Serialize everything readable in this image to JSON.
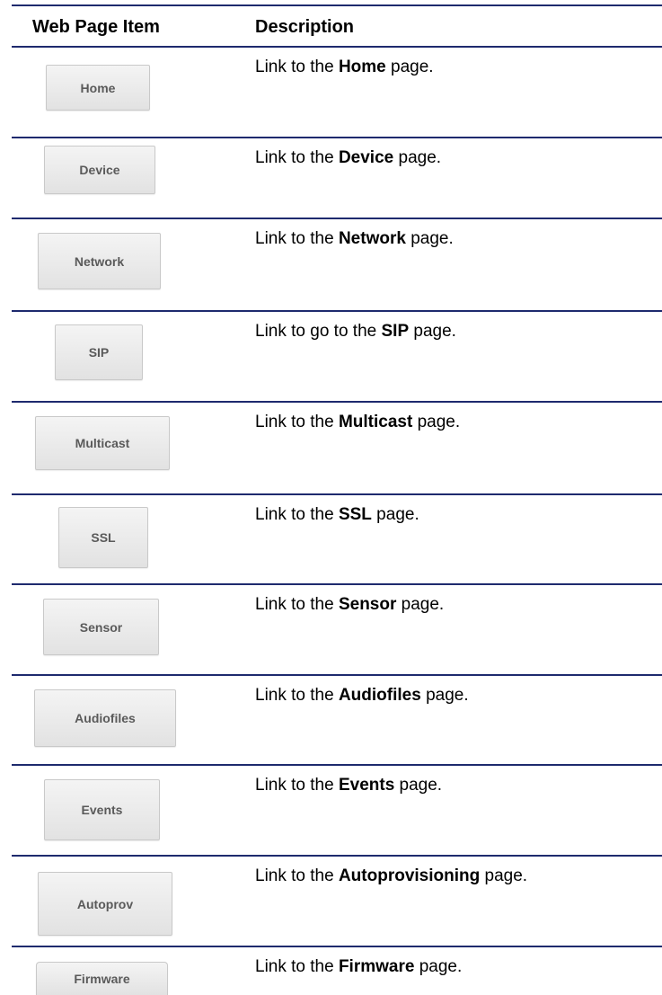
{
  "header": {
    "item_col": "Web Page Item",
    "desc_col": "Description"
  },
  "rows": [
    {
      "button": "Home",
      "prefix": "Link to the ",
      "bold": "Home",
      "suffix": " page."
    },
    {
      "button": "Device",
      "prefix": "Link to the ",
      "bold": "Device",
      "suffix": " page."
    },
    {
      "button": "Network",
      "prefix": "Link to the ",
      "bold": "Network",
      "suffix": " page."
    },
    {
      "button": "SIP",
      "prefix": "Link to go to the ",
      "bold": "SIP",
      "suffix": " page."
    },
    {
      "button": "Multicast",
      "prefix": "Link to the ",
      "bold": "Multicast",
      "suffix": " page."
    },
    {
      "button": "SSL",
      "prefix": "Link to the ",
      "bold": "SSL",
      "suffix": " page."
    },
    {
      "button": "Sensor",
      "prefix": "Link to the ",
      "bold": "Sensor",
      "suffix": " page."
    },
    {
      "button": "Audiofiles",
      "prefix": "Link to the ",
      "bold": "Audiofiles",
      "suffix": " page."
    },
    {
      "button": "Events",
      "prefix": "Link to the ",
      "bold": "Events",
      "suffix": " page."
    },
    {
      "button": "Autoprov",
      "prefix": "Link to the ",
      "bold": "Autoprovisioning",
      "suffix": " page."
    },
    {
      "button": "Firmware",
      "prefix": "Link to the ",
      "bold": "Firmware",
      "suffix": " page."
    }
  ]
}
